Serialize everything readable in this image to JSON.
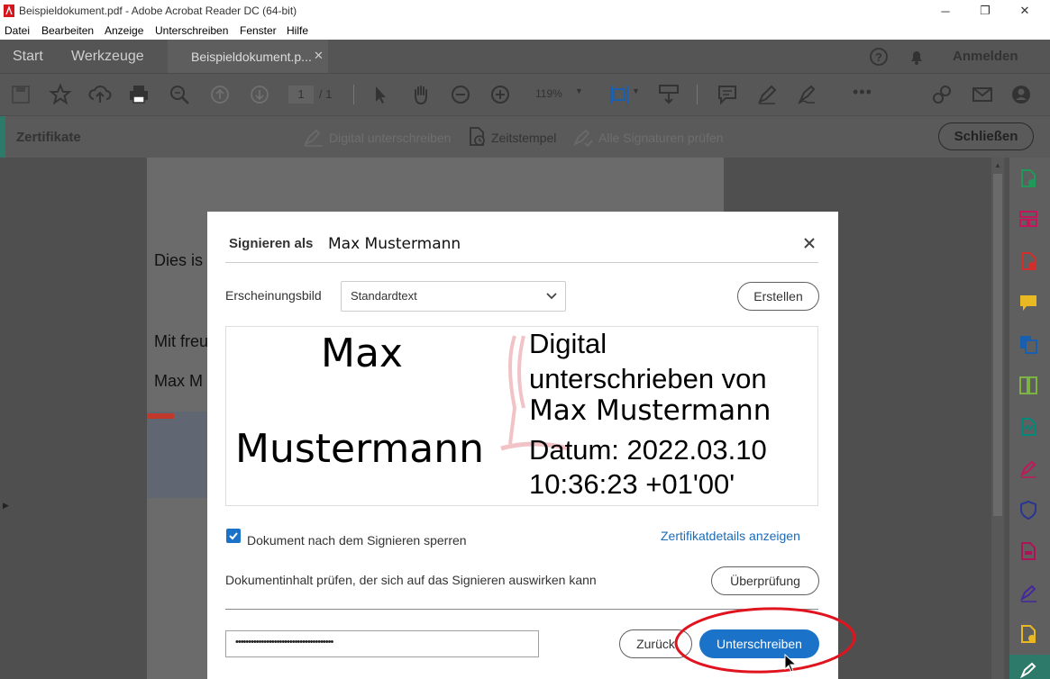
{
  "window": {
    "title": "Beispieldokument.pdf - Adobe Acrobat Reader DC (64-bit)"
  },
  "menu": [
    "Datei",
    "Bearbeiten",
    "Anzeige",
    "Unterschreiben",
    "Fenster",
    "Hilfe"
  ],
  "tabs": {
    "start": "Start",
    "tools": "Werkzeuge",
    "document": "Beispieldokument.p..."
  },
  "header": {
    "login": "Anmelden"
  },
  "toolbar": {
    "page_current": "1",
    "page_total": "/ 1",
    "zoom": "119%"
  },
  "certbar": {
    "title": "Zertifikate",
    "digital_sign": "Digital unterschreiben",
    "timestamp": "Zeitstempel",
    "verify_all": "Alle Signaturen prüfen",
    "close": "Schließen"
  },
  "document": {
    "line1": "Dies is",
    "line2": "Mit freu",
    "line3": "Max M"
  },
  "dialog": {
    "title_prefix": "Signieren als",
    "signer": "Max Mustermann",
    "appearance_label": "Erscheinungsbild",
    "appearance_value": "Standardtext",
    "create_button": "Erstellen",
    "preview": {
      "name_first": "Max",
      "name_last": "Mustermann",
      "line1": "Digital",
      "line2": "unterschrieben von",
      "line3": "Max Mustermann",
      "line4": "Datum: 2022.03.10",
      "line5": "10:36:23 +01'00'"
    },
    "lock_label": "Dokument nach dem Signieren sperren",
    "lock_checked": true,
    "cert_details_link": "Zertifikatdetails anzeigen",
    "review_label": "Dokumentinhalt prüfen, der sich auf das Signieren auswirken kann",
    "review_button": "Überprüfung",
    "password_value": "••••••••••••••••••••••••••••••••••••••",
    "back_button": "Zurück",
    "sign_button": "Unterschreiben"
  },
  "colors": {
    "accent_blue": "#1a73c8",
    "highlight_red": "#e0141e",
    "cert_accent": "#2d7a6b"
  }
}
